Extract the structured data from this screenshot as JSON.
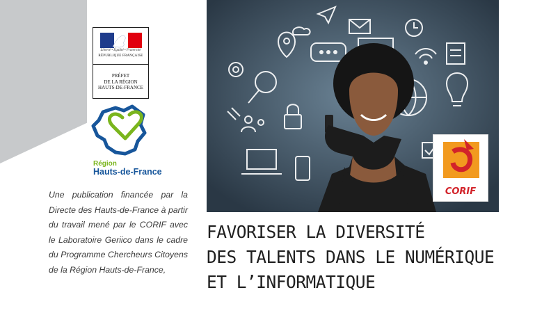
{
  "prefet_logo": {
    "devise": "Liberté • Égalité • Fraternité",
    "republique": "RÉPUBLIQUE FRANÇAISE",
    "lines": [
      "PRÉFET",
      "DE LA RÉGION",
      "HAUTS-DE-FRANCE"
    ]
  },
  "region_logo": {
    "line1": "Région",
    "line2": "Hauts-de-France"
  },
  "publication_text": "Une publication financée par la Directe des Hauts-de-France à partir du travail mené par le CORIF avec le Laboratoire Geriico dans le cadre du Programme Chercheurs Citoyens de la Région Hauts-de-France,",
  "corif_logo": {
    "label": "CORIF"
  },
  "title": {
    "line1": "FAVORISER LA DIVERSITÉ",
    "line2": "DES TALENTS DANS LE NUMÉRIQUE",
    "line3": "ET L’INFORMATIQUE"
  },
  "colors": {
    "panel": "#c7c9cb",
    "region_green": "#7ab51d",
    "region_blue": "#17569b",
    "corif_red": "#d2232a",
    "corif_orange": "#f29a1f"
  },
  "photo_icons": [
    "location-pin-icon",
    "chat-bubble-icon",
    "send-icon",
    "cloud-icon",
    "email-icon",
    "clock-icon",
    "wifi-icon",
    "document-icon",
    "lightbulb-icon",
    "magnifier-icon",
    "globe-icon",
    "padlock-icon",
    "gear-icon",
    "people-icon",
    "laptop-icon",
    "target-icon",
    "checkbox-icon",
    "phone-icon"
  ]
}
